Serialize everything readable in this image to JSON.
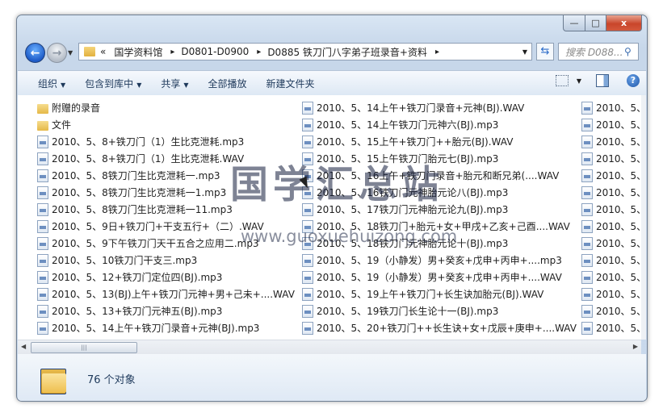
{
  "window": {
    "caption_buttons": {
      "minimize": "—",
      "maximize": "□",
      "close": "x"
    }
  },
  "address": {
    "prefix": "«",
    "crumbs": [
      "国学资料馆",
      "D0801-D0900",
      "D0885 铁刀门八字弟子班录音+资料"
    ],
    "search_placeholder": "搜索 D088..."
  },
  "toolbar": {
    "organize": "组织",
    "include_in_library": "包含到库中",
    "share": "共享",
    "play_all": "全部播放",
    "new_folder": "新建文件夹"
  },
  "files": {
    "col1": [
      {
        "name": "附赠的录音",
        "type": "folder"
      },
      {
        "name": "文件",
        "type": "folder"
      },
      {
        "name": "2010、5、8+铁刀门（1）生比克泄耗.mp3",
        "type": "audio"
      },
      {
        "name": "2010、5、8+铁刀门（1）生比克泄耗.WAV",
        "type": "audio"
      },
      {
        "name": "2010、5、8铁刀门生比克泄耗一.mp3",
        "type": "audio"
      },
      {
        "name": "2010、5、8铁刀门生比克泄耗一1.mp3",
        "type": "audio"
      },
      {
        "name": "2010、5、8铁刀门生比克泄耗一11.mp3",
        "type": "audio"
      },
      {
        "name": "2010、5、9日+铁刀门+干支五行+（二）.WAV",
        "type": "audio"
      },
      {
        "name": "2010、5、9下午铁刀门天干五合之应用二.mp3",
        "type": "audio"
      },
      {
        "name": "2010、5、10铁刀门干支三.mp3",
        "type": "audio"
      },
      {
        "name": "2010、5、12+铁刀门定位四(BJ).mp3",
        "type": "audio"
      },
      {
        "name": "2010、5、13(BJ)上午+铁刀门元神+男+己未+....WAV",
        "type": "audio"
      },
      {
        "name": "2010、5、13+铁刀门元神五(BJ).mp3",
        "type": "audio"
      },
      {
        "name": "2010、5、14上午+铁刀门录音+元神(BJ).mp3",
        "type": "audio"
      }
    ],
    "col2": [
      {
        "name": "2010、5、14上午+铁刀门录音+元神(BJ).WAV",
        "type": "audio"
      },
      {
        "name": "2010、5、14上午铁刀门元神六(BJ).mp3",
        "type": "audio"
      },
      {
        "name": "2010、5、15上午+铁刀门++胎元(BJ).WAV",
        "type": "audio"
      },
      {
        "name": "2010、5、15上午铁刀门胎元七(BJ).mp3",
        "type": "audio"
      },
      {
        "name": "2010、5、16上午+铁刀门录音+胎元和断兄弟(....WAV",
        "type": "audio"
      },
      {
        "name": "2010、5、16铁刀门元神胎元论八(BJ).mp3",
        "type": "audio"
      },
      {
        "name": "2010、5、17铁刀门元神胎元论九(BJ).mp3",
        "type": "audio"
      },
      {
        "name": "2010、5、18铁刀门+胎元+女+甲戌+乙亥+己酉....WAV",
        "type": "audio"
      },
      {
        "name": "2010、5、18铁刀门元神胎元论十(BJ).mp3",
        "type": "audio"
      },
      {
        "name": "2010、5、19（小静发）男+癸亥+戊申+丙申+....mp3",
        "type": "audio"
      },
      {
        "name": "2010、5、19（小静发）男+癸亥+戊申+丙申+....WAV",
        "type": "audio"
      },
      {
        "name": "2010、5、19上午+铁刀门+长生诀加胎元(BJ).WAV",
        "type": "audio"
      },
      {
        "name": "2010、5、19铁刀门长生论十一(BJ).mp3",
        "type": "audio"
      },
      {
        "name": "2010、5、20+铁刀门++长生诀+女+戊辰+庚申+....WAV",
        "type": "audio"
      }
    ],
    "col3": [
      {
        "name": "2010、5、",
        "type": "audio"
      },
      {
        "name": "2010、5、",
        "type": "audio"
      },
      {
        "name": "2010、5、",
        "type": "audio"
      },
      {
        "name": "2010、5、",
        "type": "audio"
      },
      {
        "name": "2010、5、",
        "type": "audio"
      },
      {
        "name": "2010、5、",
        "type": "audio"
      },
      {
        "name": "2010、5、",
        "type": "audio"
      },
      {
        "name": "2010、5、",
        "type": "audio"
      },
      {
        "name": "2010、5、",
        "type": "audio"
      },
      {
        "name": "2010、5、",
        "type": "audio"
      },
      {
        "name": "2010、5、",
        "type": "audio"
      },
      {
        "name": "2010、5、",
        "type": "audio"
      },
      {
        "name": "2010、5、",
        "type": "audio"
      },
      {
        "name": "2010、5、",
        "type": "audio"
      }
    ]
  },
  "status": {
    "count": "76 个对象"
  },
  "watermark": {
    "cn": "国学汇总站",
    "url": "www.guoxuehuizong.com"
  }
}
